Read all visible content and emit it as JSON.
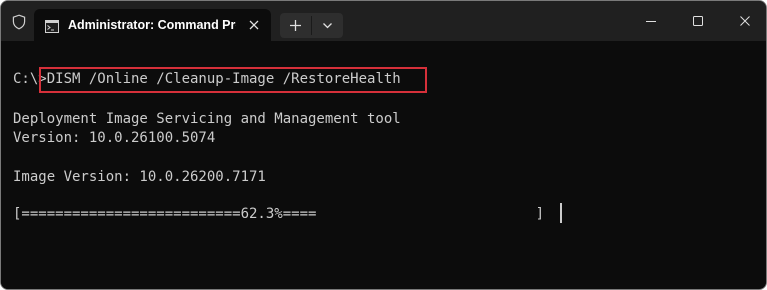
{
  "window": {
    "tab_title": "Administrator: Command Pro",
    "icons": {
      "shield": "shield-icon",
      "tab": "command-prompt-icon",
      "tab_close": "close-icon",
      "new_tab": "plus-icon",
      "dropdown": "chevron-down-icon",
      "minimize": "minimize-icon",
      "maximize": "maximize-icon",
      "close": "close-icon"
    }
  },
  "terminal": {
    "prompt": "C:\\>",
    "command": "DISM /Online /Cleanup-Image /RestoreHealth",
    "output": [
      "Deployment Image Servicing and Management tool",
      "Version: 10.0.26100.5074",
      "Image Version: 10.0.26200.7171"
    ],
    "progress": {
      "text": "[==========================62.3%====                          ]",
      "percent": 62.3
    }
  },
  "colors": {
    "titlebar": "#202020",
    "terminal_bg": "#0c0c0c",
    "text": "#cccccc",
    "highlight": "#d6303a"
  }
}
